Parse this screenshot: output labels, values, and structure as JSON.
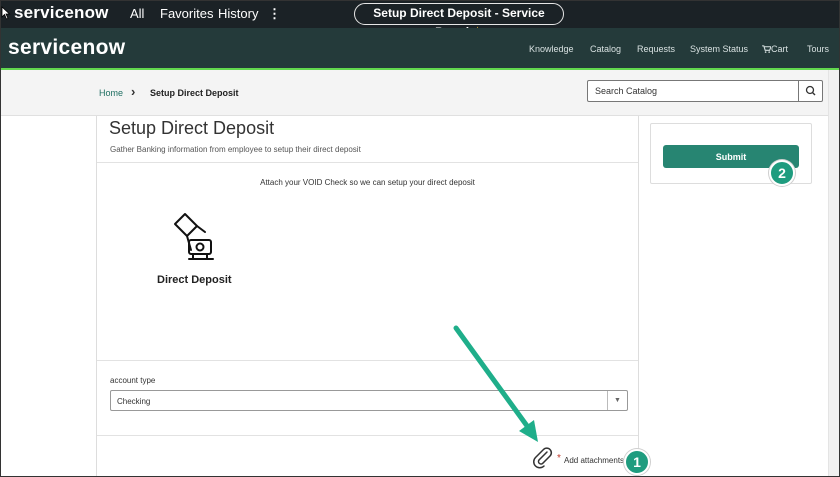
{
  "topbar": {
    "brand": "servicenow",
    "nav": [
      "All",
      "Favorites",
      "History",
      "⋮"
    ],
    "page_title": "Setup Direct Deposit - Service Portal",
    "star": "★"
  },
  "portal": {
    "logo": "servicenow",
    "menu": [
      "Knowledge",
      "Catalog",
      "Requests",
      "System Status",
      "Cart",
      "Tours"
    ]
  },
  "breadcrumb": {
    "home": "Home",
    "separator": "›",
    "current": "Setup Direct Deposit"
  },
  "search": {
    "placeholder": "Search Catalog"
  },
  "form": {
    "title": "Setup Direct Deposit",
    "description": "Gather Banking information from employee to setup their direct deposit",
    "attach_note": "Attach your VOID Check so we can setup your direct deposit",
    "image_label": "Direct Deposit",
    "account_type_label": "account type",
    "account_type_value": "Checking",
    "required_mark": "*",
    "add_attachments": "Add attachments"
  },
  "sidebar": {
    "submit_label": "Submit"
  },
  "annotations": {
    "badge1": "1",
    "badge2": "2"
  },
  "colors": {
    "accent": "#278572",
    "portal_bg": "#243a3a",
    "topbar_bg": "#1b2226",
    "green": "#62d84e",
    "arrow": "#1fae8a"
  }
}
